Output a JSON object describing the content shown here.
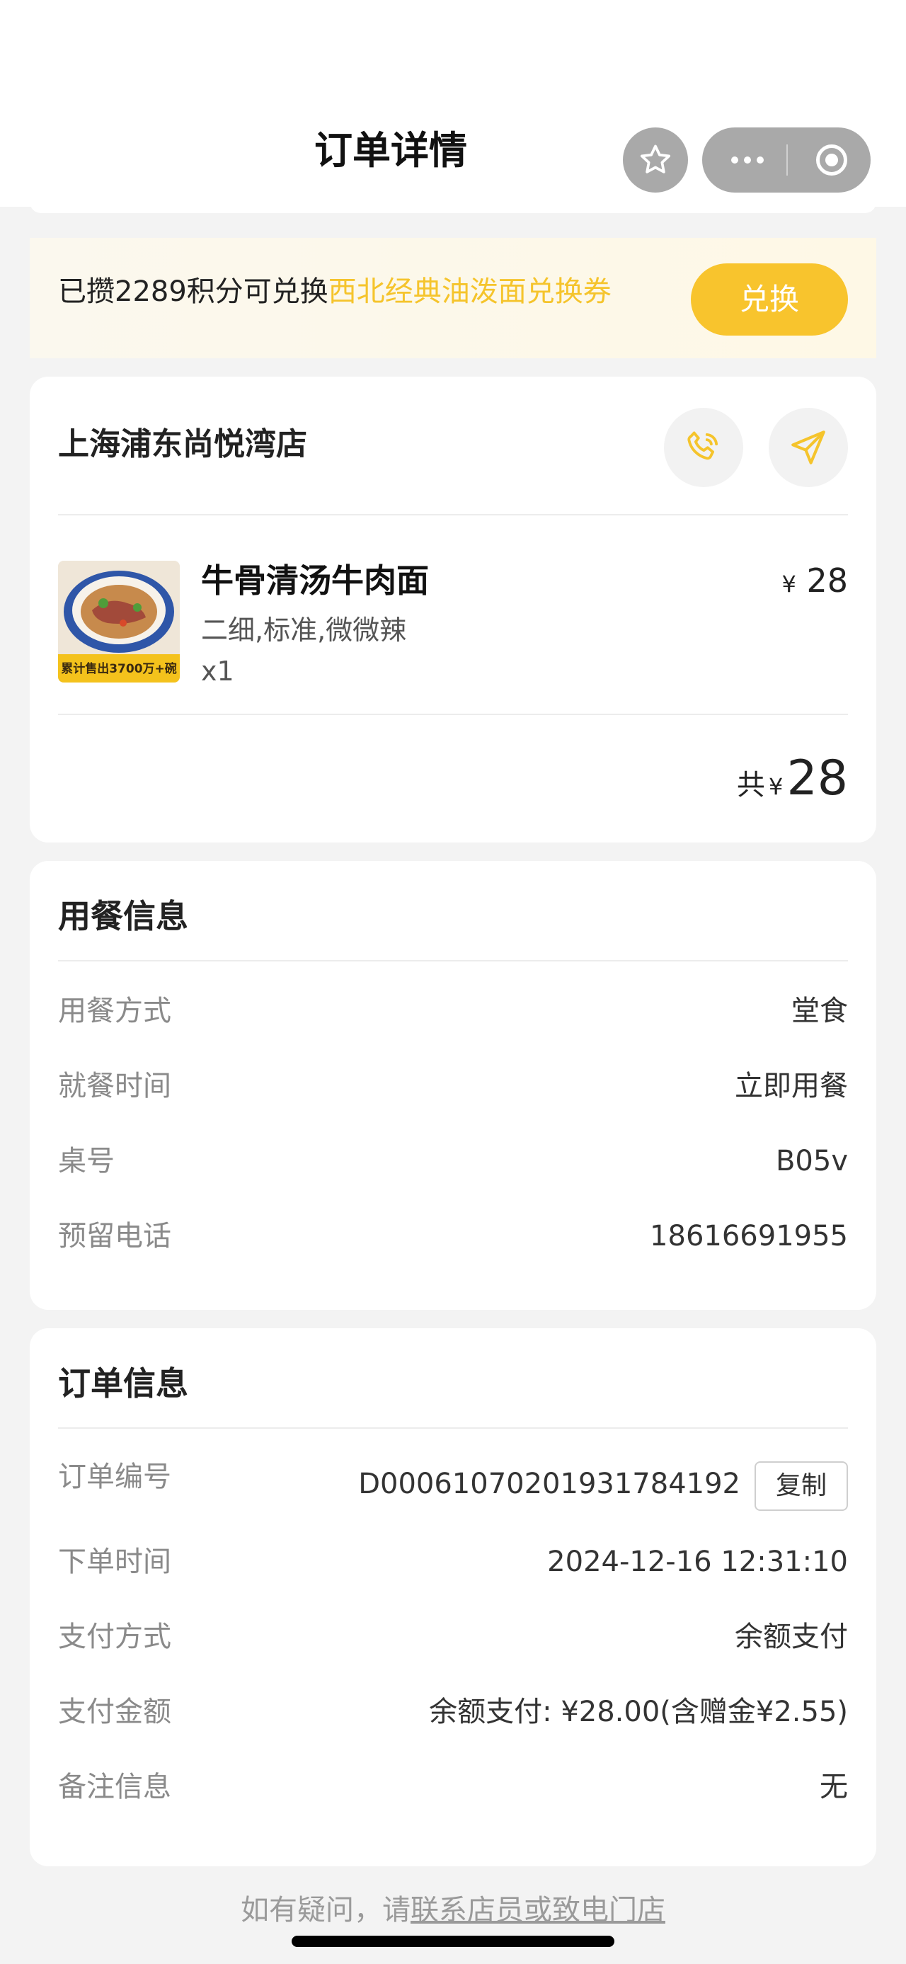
{
  "header": {
    "title": "订单详情"
  },
  "points_banner": {
    "text_prefix": "已攒2289积分可兑换",
    "highlight": "西北经典油泼面兑换券",
    "button_label": "兑换"
  },
  "store": {
    "name": "上海浦东尚悦湾店",
    "item": {
      "name": "牛骨清汤牛肉面",
      "spec": "二细,标准,微微辣",
      "qty": "x1",
      "currency": "¥",
      "price": "28",
      "image_caption": "累计售出3700万+碗"
    },
    "total": {
      "label": "共",
      "currency": "¥",
      "amount": "28"
    }
  },
  "dining": {
    "title": "用餐信息",
    "rows": [
      {
        "label": "用餐方式",
        "value": "堂食"
      },
      {
        "label": "就餐时间",
        "value": "立即用餐"
      },
      {
        "label": "桌号",
        "value": "B05v"
      },
      {
        "label": "预留电话",
        "value": "18616691955"
      }
    ]
  },
  "order": {
    "title": "订单信息",
    "copy_label": "复制",
    "rows": [
      {
        "label": "订单编号",
        "value": "D00061070201931784192"
      },
      {
        "label": "下单时间",
        "value": "2024-12-16 12:31:10"
      },
      {
        "label": "支付方式",
        "value": "余额支付"
      },
      {
        "label": "支付金额",
        "value": "余额支付: ¥28.00(含赠金¥2.55)"
      },
      {
        "label": "备注信息",
        "value": "无"
      }
    ]
  },
  "footer": {
    "prefix": "如有疑问，请",
    "link": "联系店员或致电门店"
  },
  "colors": {
    "accent": "#f8c42d",
    "highlight_text": "#f5c42c"
  }
}
